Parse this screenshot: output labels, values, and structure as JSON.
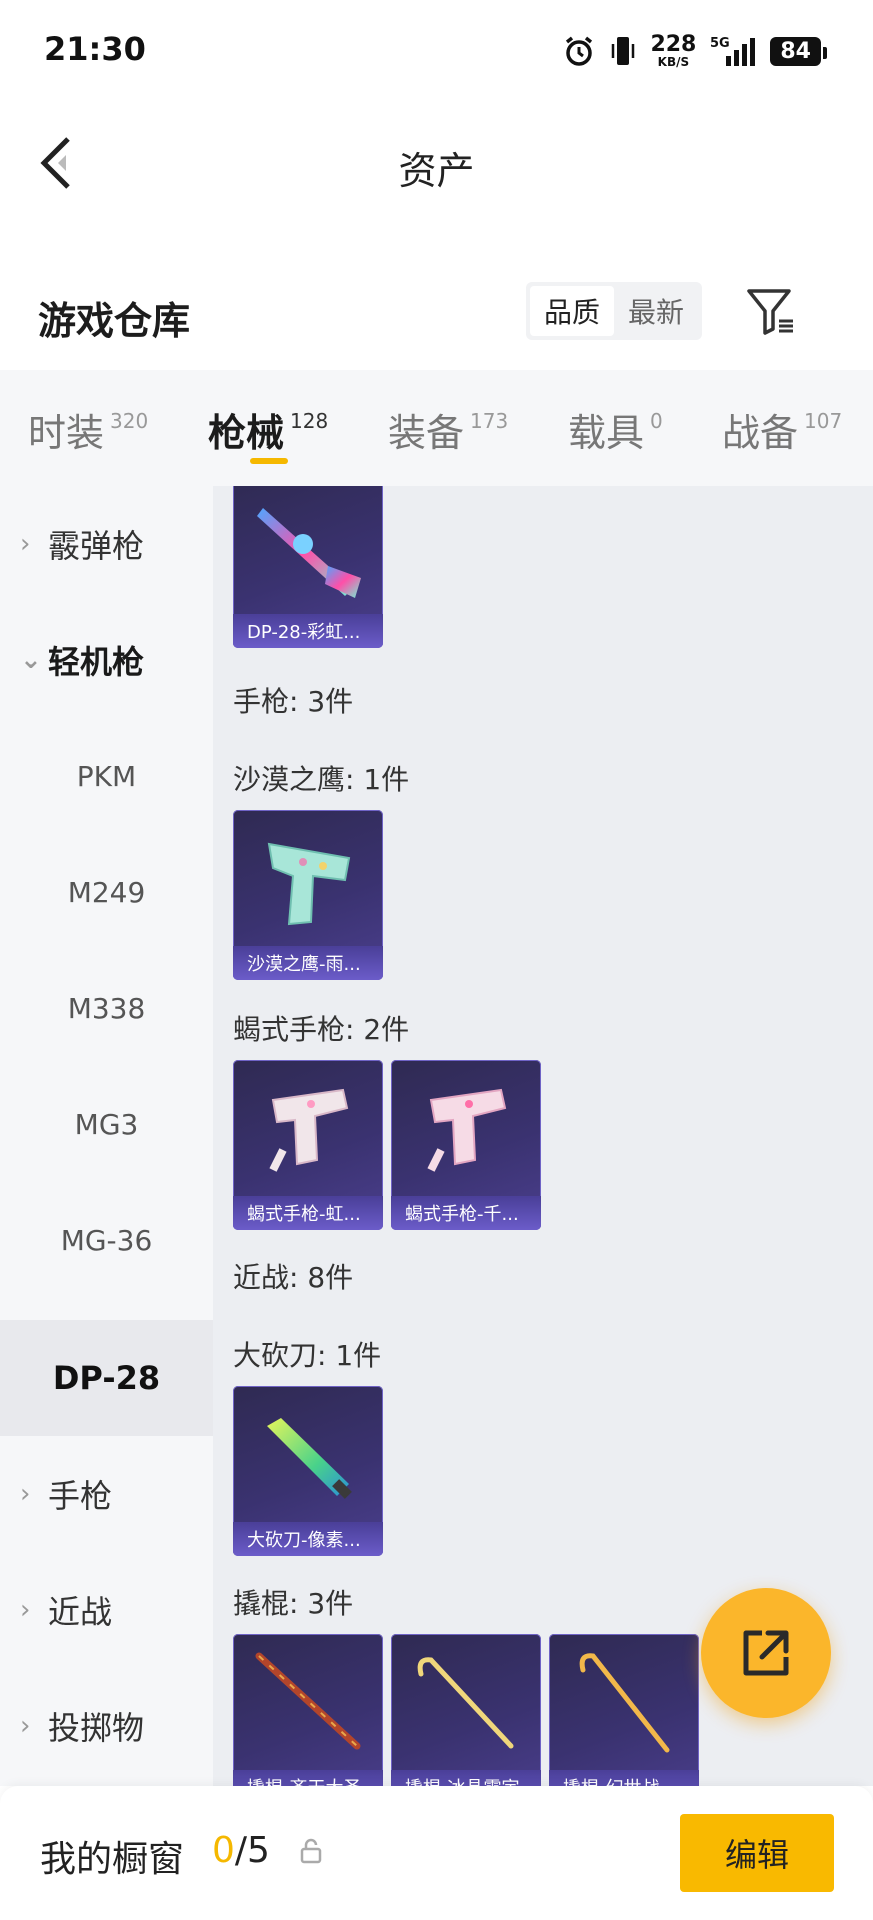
{
  "status": {
    "time": "21:30",
    "speed_value": "228",
    "speed_unit": "KB/S",
    "network": "5G",
    "battery": "84"
  },
  "header": {
    "title": "资产"
  },
  "section": {
    "title": "游戏仓库",
    "sort_quality": "品质",
    "sort_latest": "最新"
  },
  "tabs": [
    {
      "label": "时装",
      "count": "320"
    },
    {
      "label": "枪械",
      "count": "128"
    },
    {
      "label": "装备",
      "count": "173"
    },
    {
      "label": "载具",
      "count": "0"
    },
    {
      "label": "战备",
      "count": "107"
    }
  ],
  "sidebar": {
    "shotgun": "霰弹枪",
    "lmg": "轻机枪",
    "pkm": "PKM",
    "m249": "M249",
    "m338": "M338",
    "mg3": "MG3",
    "mg36": "MG-36",
    "dp28": "DP-28",
    "pistol": "手枪",
    "melee": "近战",
    "throwable": "投掷物"
  },
  "content": {
    "dp28_card": "DP-28-彩虹...",
    "pistol_group": "手枪: 3件",
    "deagle_group": "沙漠之鹰: 1件",
    "deagle_card": "沙漠之鹰-雨...",
    "scorpion_group": "蝎式手枪: 2件",
    "scorpion_card_1": "蝎式手枪-虹...",
    "scorpion_card_2": "蝎式手枪-千...",
    "melee_group": "近战: 8件",
    "machete_group": "大砍刀: 1件",
    "machete_card": "大砍刀-像素...",
    "crowbar_group": "撬棍: 3件",
    "crowbar_card_1": "撬棍-齐天大圣",
    "crowbar_card_2": "撬棍-冰晶霜宇",
    "crowbar_card_3": "撬棍-幻世战"
  },
  "bottom": {
    "label": "我的橱窗",
    "current": "0",
    "total": "/5",
    "edit": "编辑"
  },
  "colors": {
    "accent": "#f5b800",
    "card_bg": "#3a3270",
    "caption_bg": "#6b5cc9"
  }
}
